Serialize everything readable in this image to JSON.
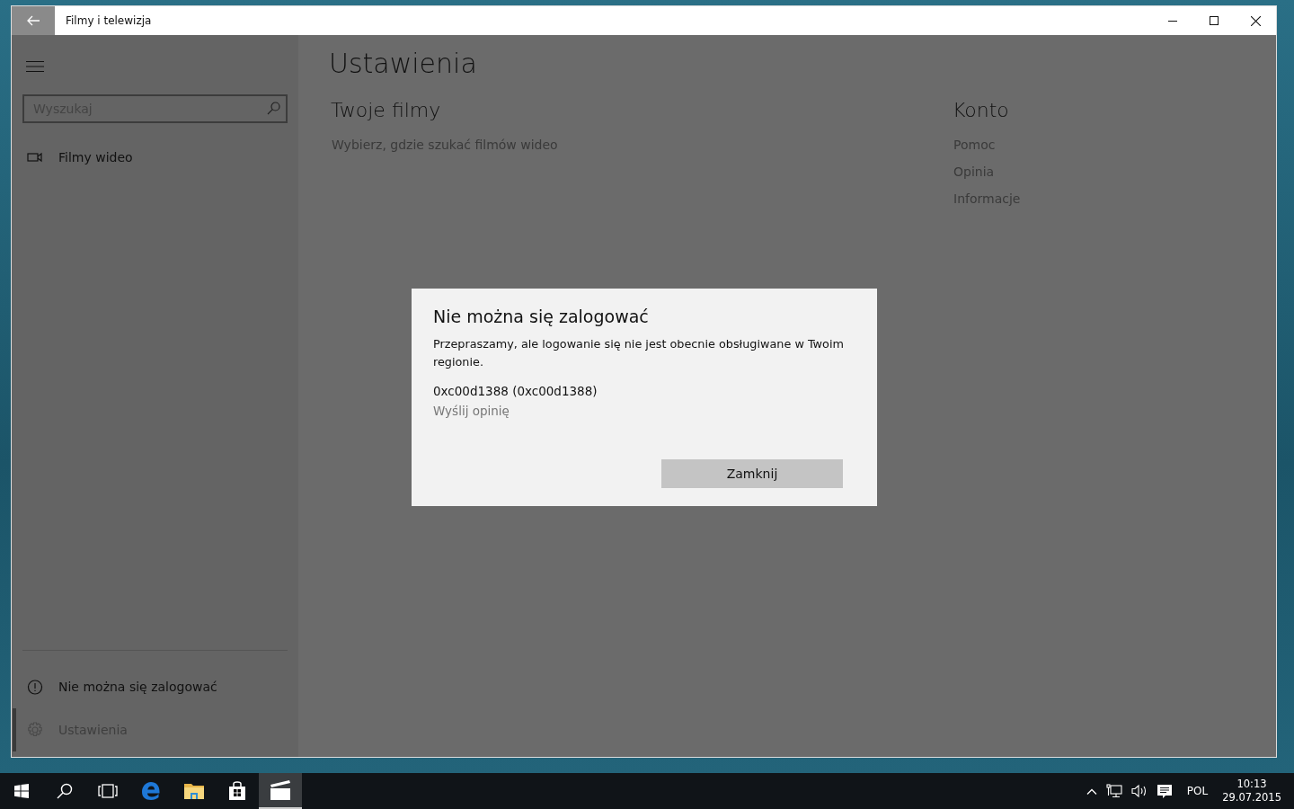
{
  "window": {
    "title": "Filmy i telewizja"
  },
  "sidebar": {
    "search": {
      "placeholder": "Wyszukaj"
    },
    "items": [
      {
        "kind": "video",
        "label": "Filmy wideo",
        "selected": false
      }
    ],
    "footer_items": [
      {
        "kind": "alert",
        "label": "Nie można się zalogować",
        "selected": false
      },
      {
        "kind": "settings",
        "label": "Ustawienia",
        "selected": true
      }
    ]
  },
  "page": {
    "title": "Ustawienia",
    "sections": [
      {
        "heading": "Twoje filmy",
        "links": [
          "Wybierz, gdzie szukać filmów wideo"
        ]
      },
      {
        "heading": "Konto",
        "links": [
          "Pomoc",
          "Opinia",
          "Informacje"
        ]
      }
    ]
  },
  "dialog": {
    "title": "Nie można się zalogować",
    "message": "Przepraszamy, ale logowanie się nie jest obecnie obsługiwane w Twoim regionie.",
    "code": "0xc00d1388 (0xc00d1388)",
    "link": "Wyślij opinię",
    "button": "Zamknij"
  },
  "taskbar": {
    "apps": [
      {
        "kind": "start",
        "selected": false
      },
      {
        "kind": "search",
        "selected": false
      },
      {
        "kind": "taskview",
        "selected": false
      },
      {
        "kind": "edge",
        "selected": false
      },
      {
        "kind": "explorer",
        "selected": false
      },
      {
        "kind": "store",
        "selected": false
      },
      {
        "kind": "movies",
        "selected": true
      }
    ],
    "language": "POL",
    "time": "10:13",
    "date": "29.07.2015"
  }
}
